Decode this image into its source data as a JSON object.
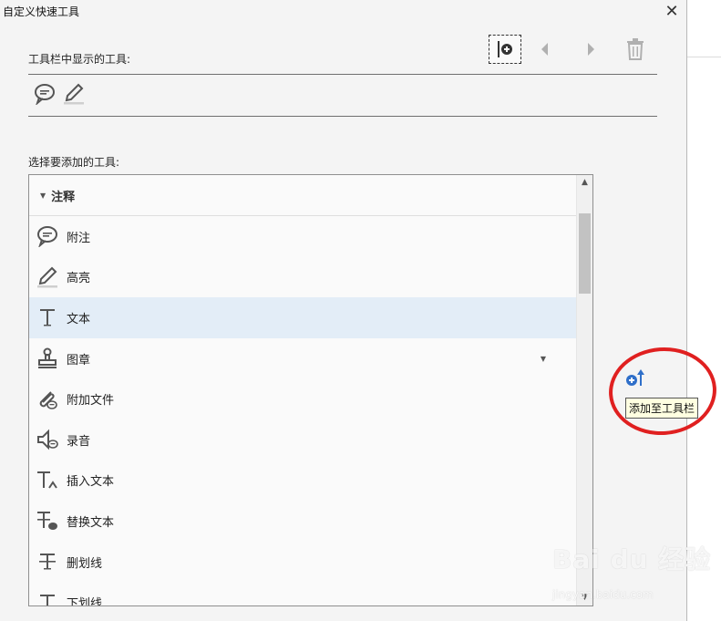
{
  "window": {
    "title": "自定义快速工具",
    "close_glyph": "✕"
  },
  "toolbar": {
    "buttons": [
      {
        "name": "add-separator",
        "icon": "separator-add-icon"
      },
      {
        "name": "move-left",
        "icon": "triangle-left-icon"
      },
      {
        "name": "move-right",
        "icon": "triangle-right-icon"
      },
      {
        "name": "delete",
        "icon": "trash-icon"
      }
    ]
  },
  "current_section": {
    "label": "工具栏中显示的工具:",
    "tools": [
      {
        "name": "comment",
        "icon": "speech-bubble-icon"
      },
      {
        "name": "highlight",
        "icon": "highlighter-icon"
      }
    ]
  },
  "available_section": {
    "label": "选择要添加的工具:",
    "group": {
      "label": "注释",
      "expanded": true
    },
    "items": [
      {
        "label": "附注",
        "icon": "speech-bubble-icon"
      },
      {
        "label": "高亮",
        "icon": "highlighter-icon"
      },
      {
        "label": "文本",
        "icon": "text-t-icon",
        "selected": true
      },
      {
        "label": "图章",
        "icon": "stamp-icon",
        "has_dropdown": true
      },
      {
        "label": "附加文件",
        "icon": "paperclip-icon"
      },
      {
        "label": "录音",
        "icon": "speaker-icon"
      },
      {
        "label": "插入文本",
        "icon": "insert-text-icon"
      },
      {
        "label": "替换文本",
        "icon": "replace-text-icon"
      },
      {
        "label": "删划线",
        "icon": "strikethrough-icon"
      },
      {
        "label": "下划线",
        "icon": "underline-icon"
      }
    ]
  },
  "add_action": {
    "tooltip": "添加至工具栏",
    "icon": "add-to-toolbar-icon"
  },
  "watermark": {
    "text": "Bai du 经验",
    "sub": "jingyan.baidu.com"
  },
  "colors": {
    "accent": "#2f6fc9",
    "selection": "#e3edf7",
    "highlight_ring": "#e02020",
    "tooltip_bg": "#ffffe1"
  }
}
